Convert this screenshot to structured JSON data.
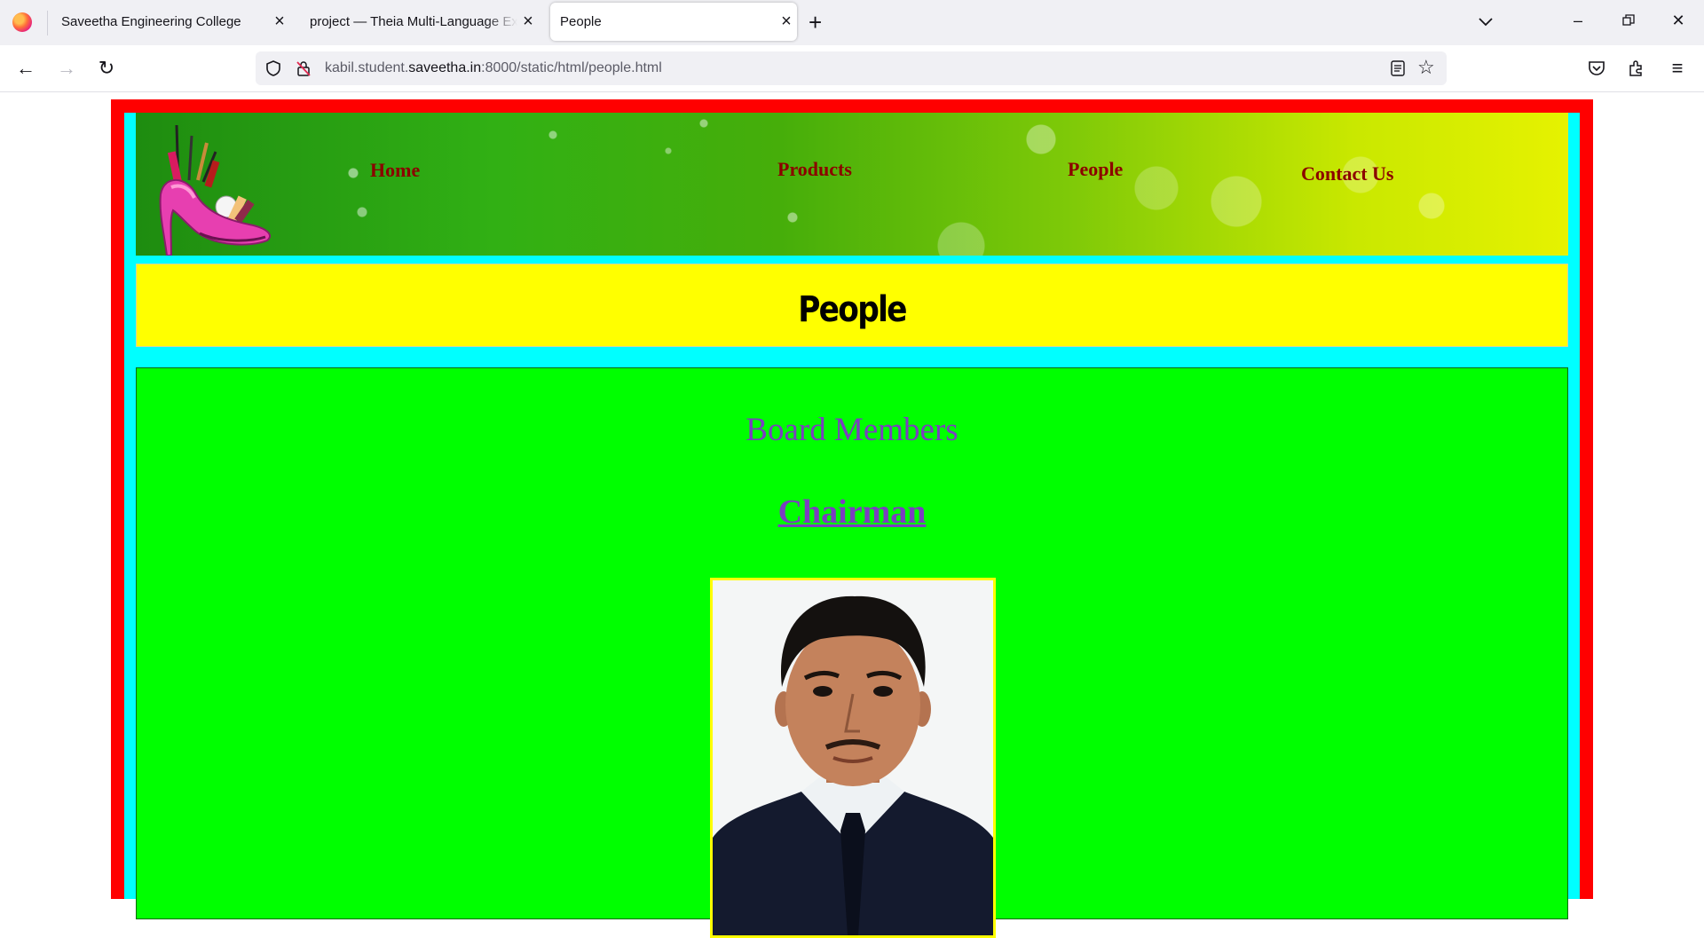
{
  "browser": {
    "tabs": [
      {
        "title": "Saveetha Engineering College",
        "active": false
      },
      {
        "title": "project — Theia Multi-Language Explorer",
        "active": false
      },
      {
        "title": "People",
        "active": true
      }
    ],
    "url": {
      "prefix": "kabil.student.",
      "domain": "saveetha.in",
      "suffix": ":8000/static/html/people.html"
    }
  },
  "site": {
    "nav": {
      "home": "Home",
      "products": "Products",
      "people": "People",
      "contact": "Contact Us"
    },
    "page_title": "People",
    "section_heading": "Board Members",
    "role_heading": "Chairman"
  },
  "colors": {
    "outer_border": "#ff0000",
    "inner_background": "#00ffff",
    "title_background": "#ffff00",
    "content_background": "#00ff00",
    "nav_text": "#8b0000",
    "heading_text": "#7b3fbf"
  }
}
